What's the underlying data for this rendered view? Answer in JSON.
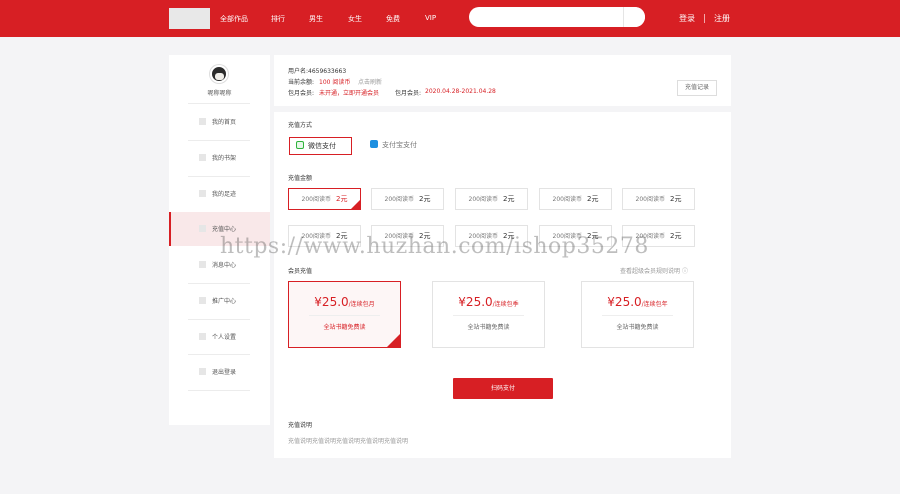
{
  "header": {
    "nav": [
      "全部作品",
      "排行",
      "男生",
      "女生",
      "免费",
      "VIP"
    ],
    "login": "登录",
    "register": "注册"
  },
  "sidebar": {
    "nickname": "呢称呢称",
    "items": [
      "我的首页",
      "我的书架",
      "我的足迹",
      "充值中心",
      "消息中心",
      "推广中心",
      "个人设置",
      "退出登录"
    ],
    "active_index": 3
  },
  "account": {
    "username": "用户名:4659633663",
    "balance_label": "当前余额:",
    "balance_value": "100 阅读币",
    "refresh": "点击刷新",
    "monthly_label": "包月会员:",
    "monthly_value": "未开通，立即开通会员",
    "monthly_period_label": "包月会员:",
    "monthly_period_value": "2020.04.28-2021.04.28",
    "recharge_log": "充值记录"
  },
  "payment": {
    "method_title": "充值方式",
    "methods": [
      "微信支付",
      "支付宝支付"
    ],
    "amount_title": "充值金额",
    "amounts": [
      {
        "coins": "200阅读币",
        "price": "2元"
      },
      {
        "coins": "200阅读币",
        "price": "2元"
      },
      {
        "coins": "200阅读币",
        "price": "2元"
      },
      {
        "coins": "200阅读币",
        "price": "2元"
      },
      {
        "coins": "200阅读币",
        "price": "2元"
      },
      {
        "coins": "200阅读币",
        "price": "2元"
      },
      {
        "coins": "200阅读币",
        "price": "2元"
      },
      {
        "coins": "200阅读币",
        "price": "2元"
      },
      {
        "coins": "200阅读币",
        "price": "2元"
      },
      {
        "coins": "200阅读币",
        "price": "2元"
      }
    ],
    "vip_title": "会员充值",
    "vip_rules": "查看超级会员规则说明",
    "vip_plans": [
      {
        "price": "¥25.0",
        "unit": "/连续包月",
        "desc": "全站书籍免费读"
      },
      {
        "price": "¥25.0",
        "unit": "/连续包季",
        "desc": "全站书籍免费读"
      },
      {
        "price": "¥25.0",
        "unit": "/连续包年",
        "desc": "全站书籍免费读"
      }
    ],
    "pay_button": "扫码支付",
    "note_title": "充值说明",
    "note_text": "充值说明充值说明充值说明充值说明充值说明"
  },
  "watermark": "https://www.huzhan.com/ishop35278",
  "colors": {
    "brand": "#d71f24",
    "wechat": "#2fb43b",
    "alipay": "#1d8fe0"
  }
}
